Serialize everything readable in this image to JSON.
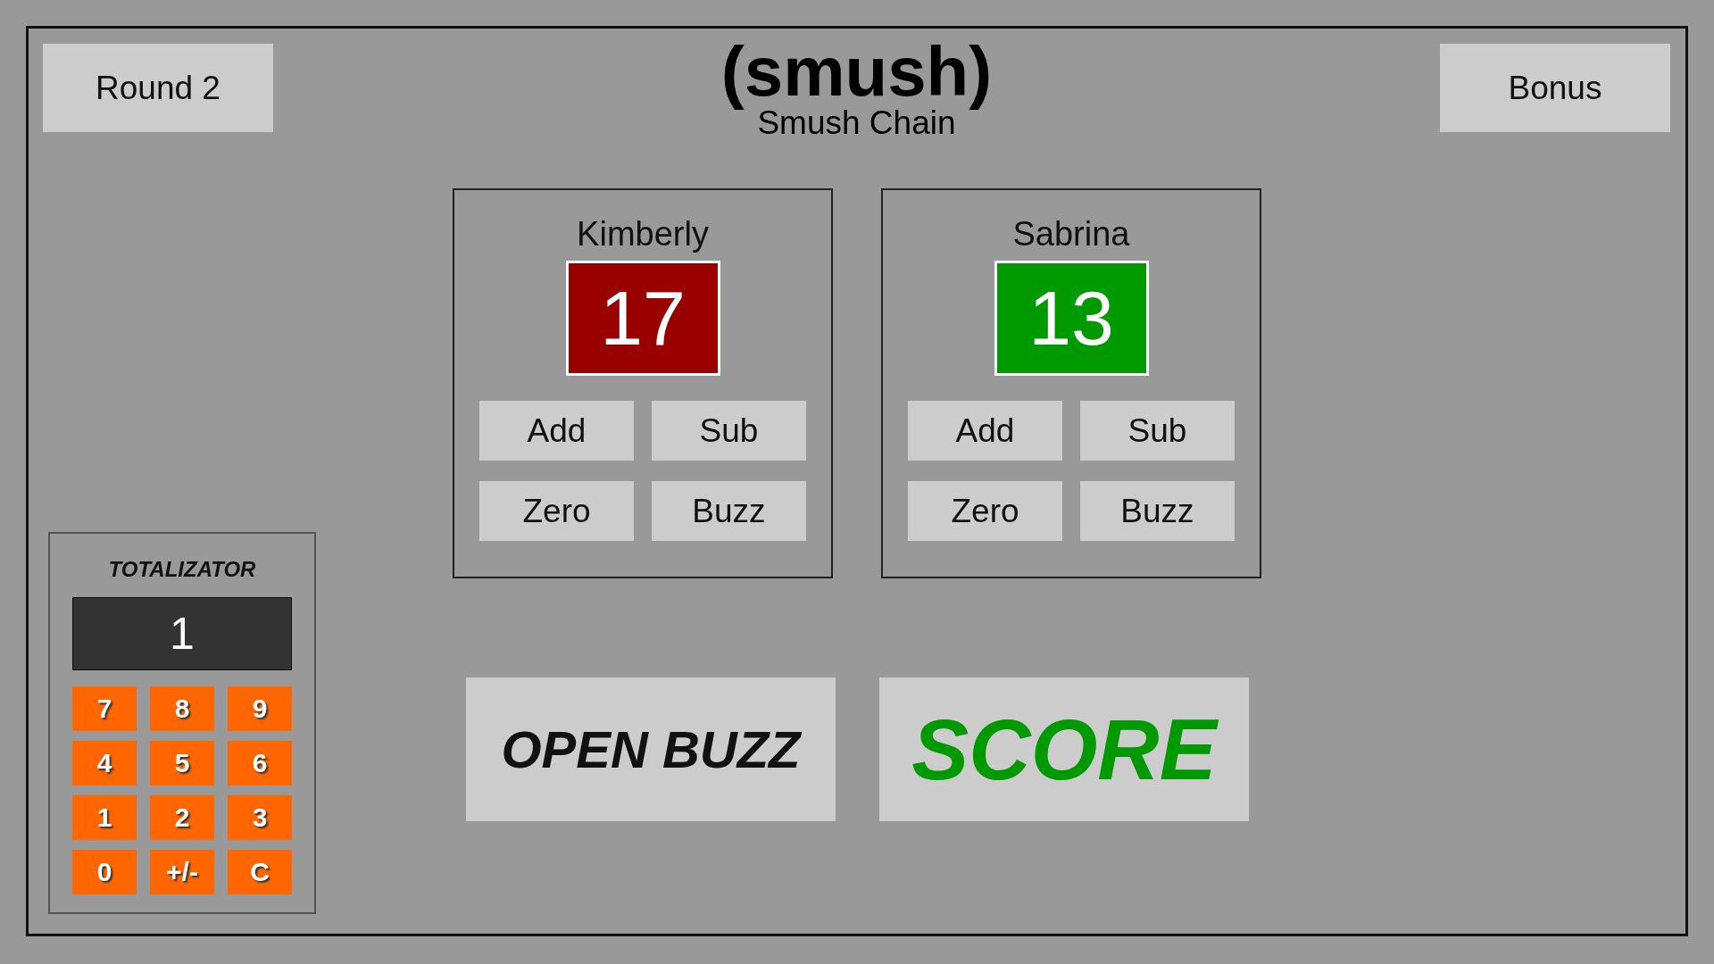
{
  "header": {
    "round_button": "Round 2",
    "title": "(smush)",
    "subtitle": "Smush Chain",
    "bonus_button": "Bonus"
  },
  "players": [
    {
      "name": "Kimberly",
      "score": "17",
      "color": "#990000",
      "buttons": [
        "Add",
        "Sub",
        "Zero",
        "Buzz"
      ]
    },
    {
      "name": "Sabrina",
      "score": "13",
      "color": "#009900",
      "buttons": [
        "Add",
        "Sub",
        "Zero",
        "Buzz"
      ]
    }
  ],
  "actions": [
    {
      "kind": "open",
      "label": "OPEN BUZZ"
    },
    {
      "kind": "score",
      "label": "SCORE"
    }
  ],
  "totalizator": {
    "title": "TOTALIZATOR",
    "display": "1",
    "keys": [
      "7",
      "8",
      "9",
      "4",
      "5",
      "6",
      "1",
      "2",
      "3",
      "0",
      "+/-",
      "C"
    ]
  }
}
